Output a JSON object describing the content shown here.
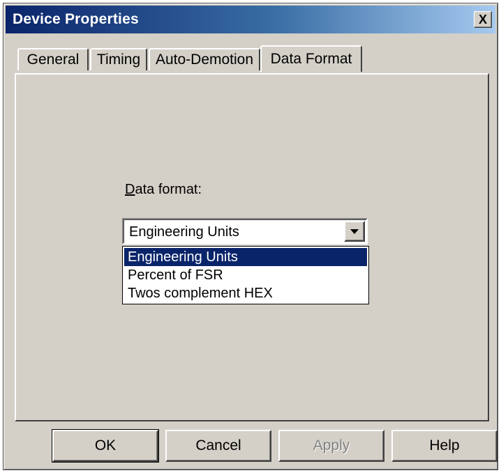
{
  "window": {
    "title": "Device Properties",
    "close_label": "X"
  },
  "tabs": [
    {
      "label": "General",
      "active": false
    },
    {
      "label": "Timing",
      "active": false
    },
    {
      "label": "Auto-Demotion",
      "active": false
    },
    {
      "label": "Data Format",
      "active": true
    }
  ],
  "data_format": {
    "label_mnemonic": "D",
    "label_rest": "ata format:",
    "selected_value": "Engineering Units",
    "options": [
      "Engineering Units",
      "Percent of FSR",
      "Twos complement HEX"
    ],
    "highlighted_index": 0
  },
  "buttons": {
    "ok": "OK",
    "cancel": "Cancel",
    "apply": "Apply",
    "help": "Help"
  },
  "colors": {
    "selection": "#0a246a",
    "face": "#d4d0c8"
  }
}
